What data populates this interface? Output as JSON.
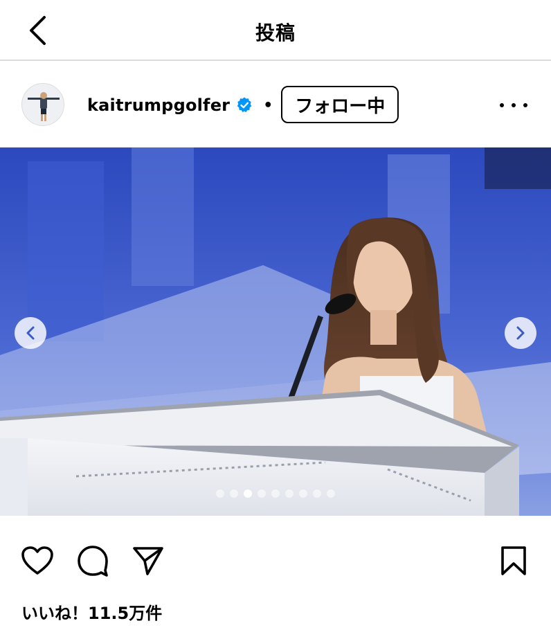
{
  "header": {
    "title": "投稿",
    "back_icon": "chevron-left-icon"
  },
  "post": {
    "username": "kaitrumpgolfer",
    "verified_icon": "verified-badge-icon",
    "separator": "•",
    "follow_label": "フォロー中",
    "more_icon": "more-horizontal-icon"
  },
  "carousel": {
    "prev_icon": "chevron-left-icon",
    "next_icon": "chevron-right-icon",
    "slide_count": 9,
    "active_index": 2
  },
  "actions": {
    "like_icon": "heart-icon",
    "comment_icon": "comment-icon",
    "share_icon": "send-icon",
    "save_icon": "bookmark-icon"
  },
  "likes": {
    "text": "いいね！11.5万件"
  },
  "colors": {
    "verified": "#0095f6",
    "divider": "#dbdbdb"
  }
}
